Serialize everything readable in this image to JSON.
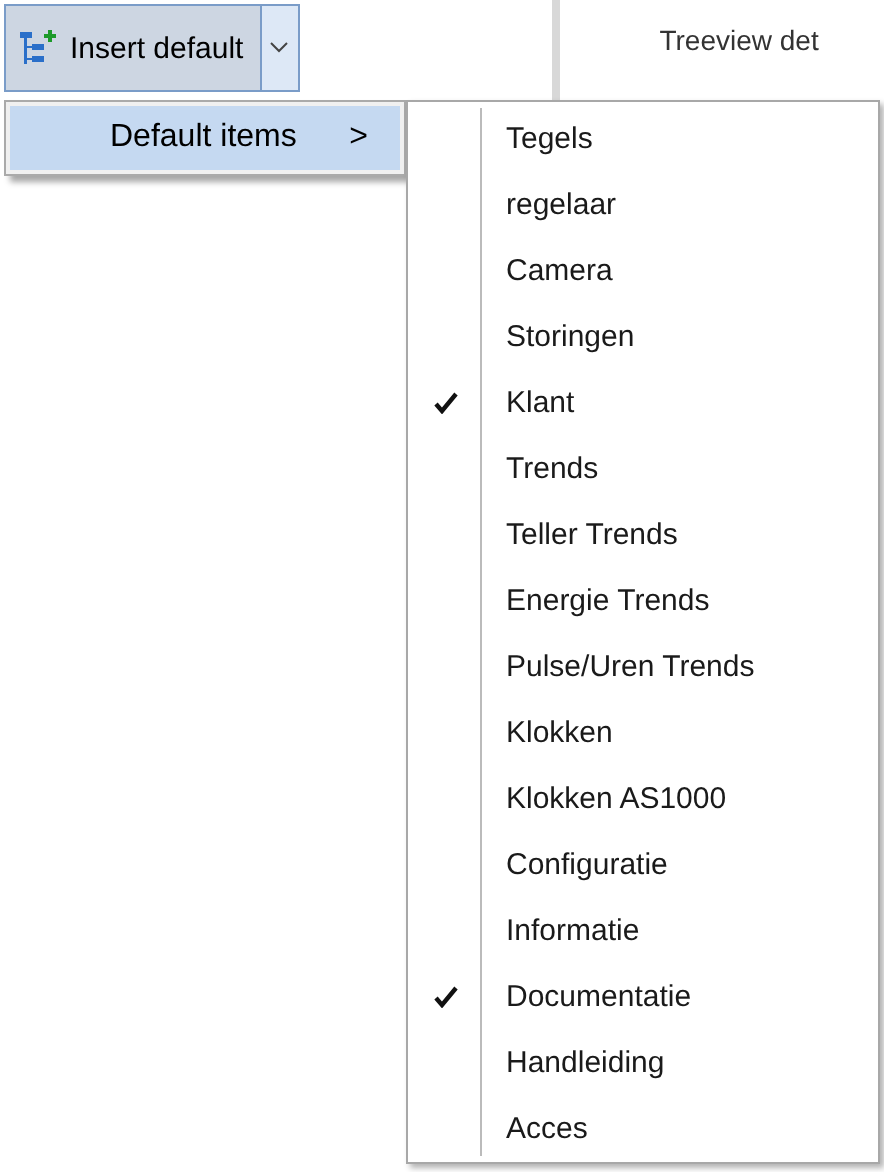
{
  "toolbar": {
    "insert_button": {
      "label": "Insert default"
    },
    "tab_title": "Treeview det"
  },
  "menu": {
    "items": [
      {
        "label": "Default items",
        "arrow": ">",
        "selected": true
      }
    ]
  },
  "submenu": {
    "items": [
      {
        "label": "Tegels",
        "checked": false
      },
      {
        "label": "regelaar",
        "checked": false
      },
      {
        "label": "Camera",
        "checked": false
      },
      {
        "label": "Storingen",
        "checked": false
      },
      {
        "label": "Klant",
        "checked": true
      },
      {
        "label": "Trends",
        "checked": false
      },
      {
        "label": "Teller Trends",
        "checked": false
      },
      {
        "label": "Energie Trends",
        "checked": false
      },
      {
        "label": "Pulse/Uren Trends",
        "checked": false
      },
      {
        "label": "Klokken",
        "checked": false
      },
      {
        "label": "Klokken AS1000",
        "checked": false
      },
      {
        "label": "Configuratie",
        "checked": false
      },
      {
        "label": "Informatie",
        "checked": false
      },
      {
        "label": "Documentatie",
        "checked": true
      },
      {
        "label": "Handleiding",
        "checked": false
      },
      {
        "label": "Acces",
        "checked": false
      }
    ]
  }
}
